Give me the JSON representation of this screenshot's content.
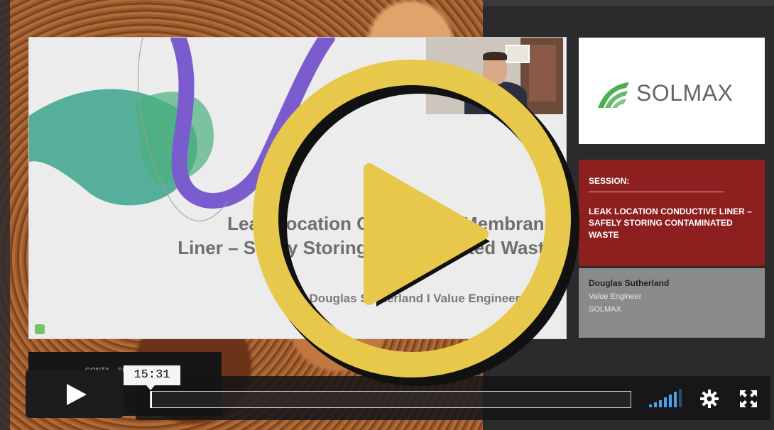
{
  "slide": {
    "title_line1": "Leak Location Conductive Membrane",
    "title_line2": "Liner – Safely Storing Contaminated Waste",
    "author": "Douglas Sutherland I Value Engineer EMEA"
  },
  "sidebar": {
    "brand": "SOLMAX",
    "session_label": "SESSION:",
    "session_title": "LEAK LOCATION CONDUCTIVE LINER – SAFELY STORING CONTAMINATED WASTE",
    "speaker_name": "Douglas Sutherland",
    "speaker_role": "Value Engineer",
    "speaker_org": "SOLMAX"
  },
  "player": {
    "hover_time": "15:31",
    "progress_fraction": 0.0,
    "accent_color": "#e8c84a",
    "icons": [
      "play-icon",
      "volume-icon",
      "gear-icon",
      "fullscreen-icon"
    ]
  },
  "thumbnail": {
    "text": "CONTA... SPOT..."
  }
}
